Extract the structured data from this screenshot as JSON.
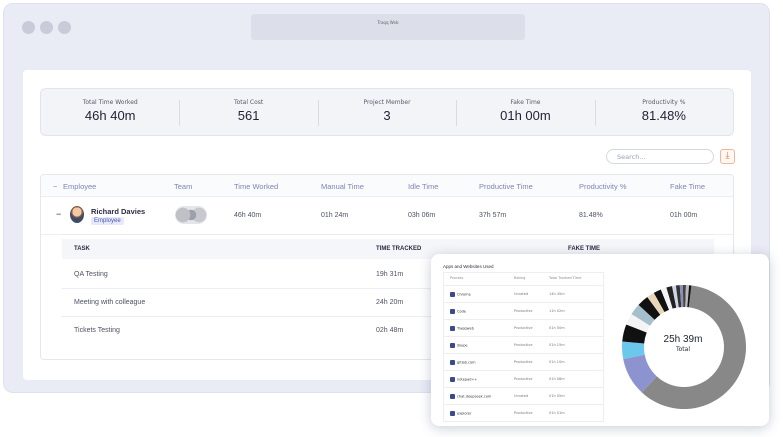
{
  "window": {
    "title": "Traqq Web"
  },
  "stats": [
    {
      "label": "Total Time Worked",
      "value": "46h 40m"
    },
    {
      "label": "Total Cost",
      "value": "561"
    },
    {
      "label": "Project Member",
      "value": "3"
    },
    {
      "label": "Fake Time",
      "value": "01h 00m"
    },
    {
      "label": "Productivity %",
      "value": "81.48%"
    }
  ],
  "search": {
    "placeholder": "Search..."
  },
  "download_icon": "download-icon",
  "table": {
    "collapse_symbol": "−",
    "headers": [
      "Employee",
      "Team",
      "Time Worked",
      "Manual Time",
      "Idle Time",
      "Productive Time",
      "Productivity %",
      "Fake Time"
    ],
    "row": {
      "expand_symbol": "−",
      "name": "Richard Davies",
      "role": "Employee",
      "time_worked": "46h 40m",
      "manual_time": "01h 24m",
      "idle_time": "03h 06m",
      "productive_time": "37h 57m",
      "productivity": "81.48%",
      "fake_time": "01h 00m"
    },
    "sub_headers": [
      "TASK",
      "TIME TRACKED",
      "FAKE TIME"
    ],
    "tasks": [
      {
        "name": "QA Testing",
        "time": "19h 31m"
      },
      {
        "name": "Meeting with colleague",
        "time": "24h 20m"
      },
      {
        "name": "Tickets Testing",
        "time": "02h 48m"
      }
    ]
  },
  "popup": {
    "title": "Apps and Websites Used",
    "headers": [
      "Process",
      "Rating",
      "Total Tracked Time"
    ],
    "rows": [
      {
        "name": "Chrome",
        "rating": "Unrated",
        "time": "14h 45m"
      },
      {
        "name": "Code",
        "rating": "Productive",
        "time": "11h 02m"
      },
      {
        "name": "Traqqweb",
        "rating": "Productive",
        "time": "01h 50m"
      },
      {
        "name": "Skype",
        "rating": "Productive",
        "time": "01h 15m"
      },
      {
        "name": "gitlab.com",
        "rating": "Productive",
        "time": "01h 10m"
      },
      {
        "name": "notepad++",
        "rating": "Productive",
        "time": "01h 08m"
      },
      {
        "name": "chat.deepseek.com",
        "rating": "Unrated",
        "time": "01h 05m"
      },
      {
        "name": "explorer",
        "rating": "Productive",
        "time": "01h 01m"
      }
    ],
    "donut": {
      "total_value": "25h 39m",
      "total_label": "Total",
      "segments": [
        {
          "color": "#888888",
          "value": 60
        },
        {
          "color": "#8d93cf",
          "value": 10
        },
        {
          "color": "#6cc7ec",
          "value": 4.5
        },
        {
          "color": "#111111",
          "value": 4.5
        },
        {
          "color": "#f4f4f4",
          "value": 3
        },
        {
          "color": "#a5c0cc",
          "value": 3
        },
        {
          "color": "#111111",
          "value": 3
        },
        {
          "color": "#e9d6b8",
          "value": 2
        },
        {
          "color": "#111111",
          "value": 2
        },
        {
          "color": "#f4f4f4",
          "value": 1.5
        },
        {
          "color": "#222222",
          "value": 1.5
        },
        {
          "color": "#cfd5e6",
          "value": 1
        },
        {
          "color": "#333333",
          "value": 1
        },
        {
          "color": "#8a8fb8",
          "value": 0.8
        },
        {
          "color": "#444444",
          "value": 0.8
        },
        {
          "color": "#bbbbbb",
          "value": 0.8
        },
        {
          "color": "#111111",
          "value": 0.6
        }
      ]
    }
  }
}
